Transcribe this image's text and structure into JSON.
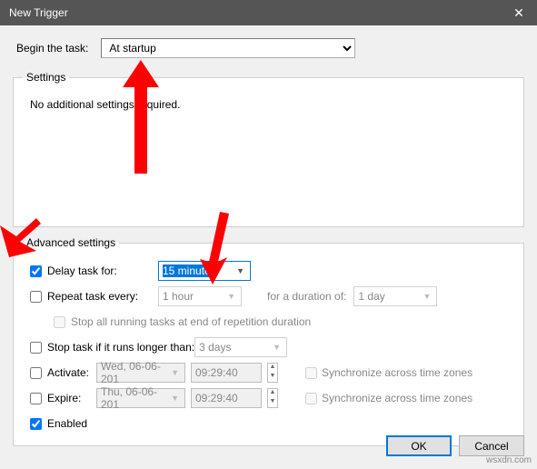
{
  "window": {
    "title": "New Trigger"
  },
  "begin": {
    "label": "Begin the task:",
    "value": "At startup"
  },
  "settingsGroup": {
    "legend": "Settings",
    "text": "No additional settings required."
  },
  "advanced": {
    "legend": "Advanced settings",
    "delay": {
      "label": "Delay task for:",
      "checked": true,
      "value": "15 minutes"
    },
    "repeat": {
      "label": "Repeat task every:",
      "checked": false,
      "value": "1 hour",
      "durationLabel": "for a duration of:",
      "durationValue": "1 day",
      "stopAtEnd": "Stop all running tasks at end of repetition duration"
    },
    "stopIfLonger": {
      "label": "Stop task if it runs longer than:",
      "checked": false,
      "value": "3 days"
    },
    "activate": {
      "label": "Activate:",
      "checked": false,
      "date": "Wed, 06-06-201",
      "time": "09:29:40",
      "syncLabel": "Synchronize across time zones"
    },
    "expire": {
      "label": "Expire:",
      "checked": false,
      "date": "Thu, 06-06-201",
      "time": "09:29:40",
      "syncLabel": "Synchronize across time zones"
    },
    "enabled": {
      "label": "Enabled",
      "checked": true
    }
  },
  "footer": {
    "ok": "OK",
    "cancel": "Cancel"
  },
  "watermark": "wsxdn.com"
}
